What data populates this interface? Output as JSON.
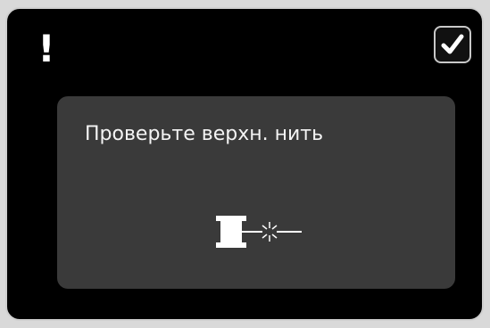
{
  "alert": {
    "symbol": "!"
  },
  "toolbar": {
    "confirm_icon": "checkmark-icon"
  },
  "message": {
    "title": "Проверьте верхн. нить",
    "icon": "thread-spool-broken-icon"
  },
  "colors": {
    "background": "#000000",
    "panel": "#3a3a3a",
    "text": "#f4f4f4",
    "icon": "#ffffff"
  }
}
